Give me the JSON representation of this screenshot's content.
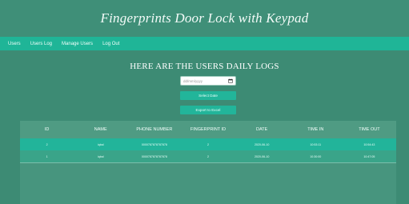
{
  "header": {
    "title": "Fingerprints Door Lock with Keypad"
  },
  "nav": {
    "items": [
      {
        "label": "Users"
      },
      {
        "label": "Users Log"
      },
      {
        "label": "Manage Users"
      },
      {
        "label": "Log Out"
      }
    ]
  },
  "main": {
    "heading": "HERE ARE THE USERS DAILY LOGS",
    "date_input": {
      "placeholder": "dd/mm/yyyy"
    },
    "select_button": "Select Date",
    "export_button": "Export to Excel"
  },
  "table": {
    "columns": [
      "ID",
      "NAME",
      "PHONE NUMBER",
      "FINGERPRINT ID",
      "DATE",
      "TIME IN",
      "TIME OUT"
    ],
    "rows": [
      [
        "2",
        "iqbal",
        "0000787878787878",
        "2",
        "2020-06-10",
        "10:53:11",
        "10:54:43"
      ],
      [
        "1",
        "iqbal",
        "0000787878787878",
        "2",
        "2020-06-10",
        "10:30:00",
        "10:47:05"
      ]
    ]
  },
  "colors": {
    "background": "#3c8a74",
    "navbar": "#1fb597",
    "accent": "#22b59a"
  }
}
